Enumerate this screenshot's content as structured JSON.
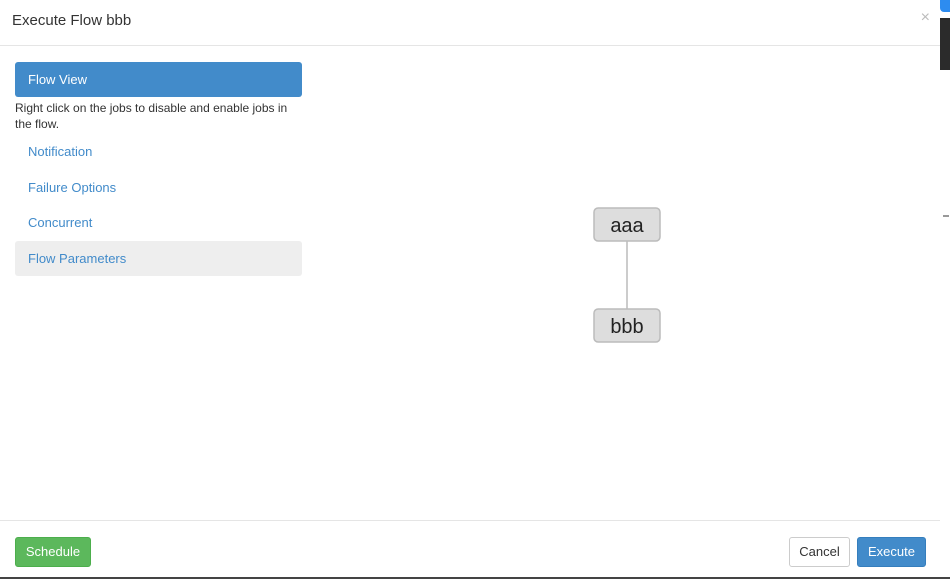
{
  "modal": {
    "title": "Execute Flow bbb",
    "close_label": "×"
  },
  "nav": {
    "items": [
      {
        "label": "Flow View"
      },
      {
        "label": "Notification"
      },
      {
        "label": "Failure Options"
      },
      {
        "label": "Concurrent"
      },
      {
        "label": "Flow Parameters"
      }
    ],
    "help_text": "Right click on the jobs to disable and enable jobs in the flow."
  },
  "graph": {
    "nodes": [
      {
        "label": "aaa"
      },
      {
        "label": "bbb"
      }
    ],
    "edges": [
      {
        "from": "aaa",
        "to": "bbb"
      }
    ]
  },
  "footer": {
    "schedule_label": "Schedule",
    "cancel_label": "Cancel",
    "execute_label": "Execute"
  },
  "colors": {
    "primary": "#428bca",
    "success": "#5cb85c",
    "node_fill": "#dddddd",
    "node_border": "#bbbbbb"
  }
}
